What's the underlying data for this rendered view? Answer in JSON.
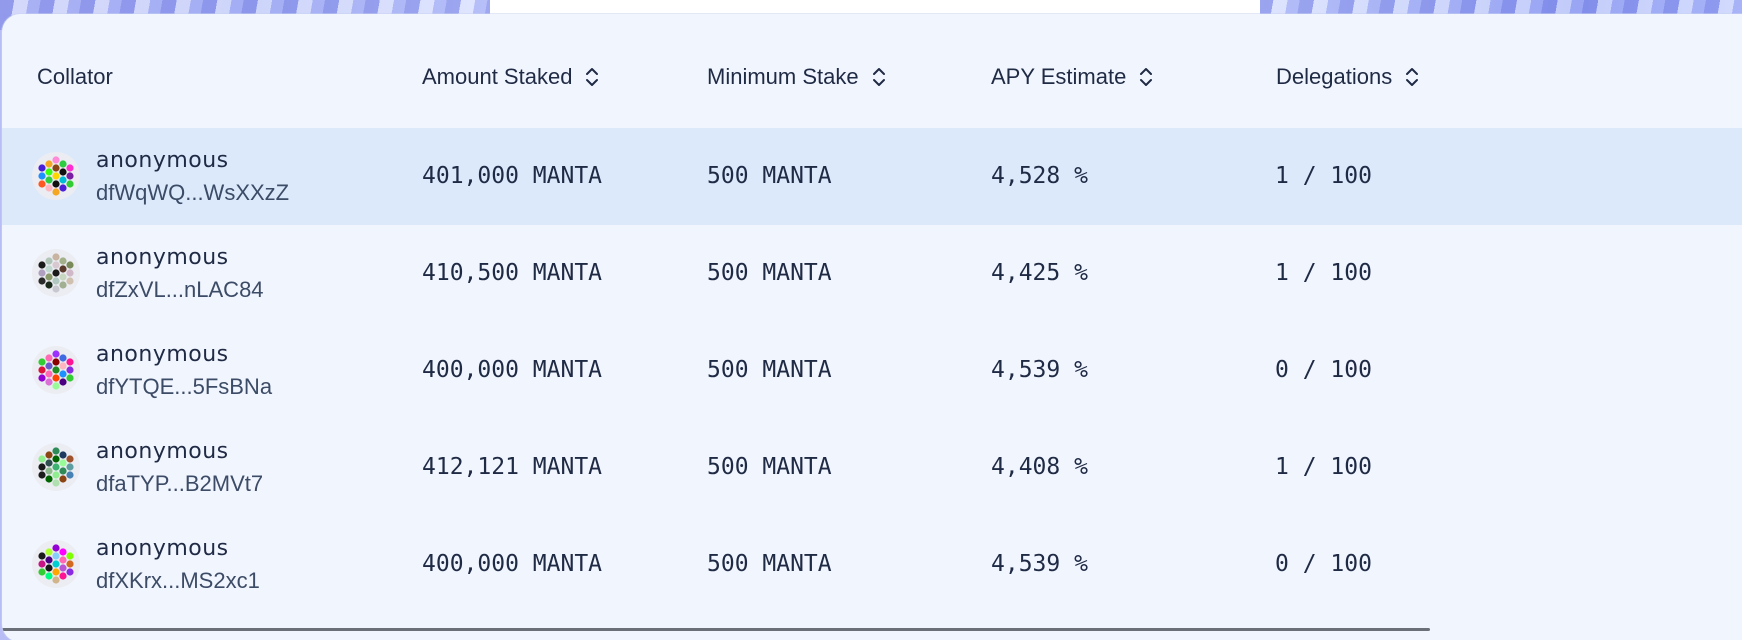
{
  "table": {
    "headers": [
      {
        "label": "Collator",
        "sortable": false
      },
      {
        "label": "Amount Staked",
        "sortable": true
      },
      {
        "label": "Minimum Stake",
        "sortable": true
      },
      {
        "label": "APY Estimate",
        "sortable": true
      },
      {
        "label": "Delegations",
        "sortable": true
      }
    ],
    "rows": [
      {
        "name": "anonymous",
        "address": "dfWqWQ...WsXXzZ",
        "amount_staked": "401,000 MANTA",
        "minimum_stake": "500 MANTA",
        "apy": "4,528 %",
        "delegations": "1 / 100",
        "avatar_colors": [
          "#ff8ad8",
          "#f5a623",
          "#2ecc40",
          "#4a1fd8",
          "#8b4513",
          "#ff2fd0",
          "#39ff14",
          "#111111",
          "#1e90ff",
          "#ffd700",
          "#7b1fa2",
          "#2ecc40",
          "#00bcd4",
          "#ff5722",
          "#111111",
          "#32cd32",
          "#ffb6c1",
          "#4a1fd8",
          "#f5a623"
        ]
      },
      {
        "name": "anonymous",
        "address": "dfZxVL...nLAC84",
        "amount_staked": "410,500 MANTA",
        "minimum_stake": "500 MANTA",
        "apy": "4,425 %",
        "delegations": "1 / 100",
        "avatar_colors": [
          "#c8b4a0",
          "#b0c4b8",
          "#a3b18a",
          "#1a1a1a",
          "#d8c8d0",
          "#7a8b5a",
          "#c0d8d0",
          "#5a3a2a",
          "#b0a0c0",
          "#1a1a1a",
          "#d0b8c8",
          "#8a9a6a",
          "#c8d8c0",
          "#2a2a2a",
          "#b0c8c0",
          "#d0c0b0",
          "#1a2a1a",
          "#a0b090",
          "#c8c8d0"
        ]
      },
      {
        "name": "anonymous",
        "address": "dfYTQE...5FsBNa",
        "amount_staked": "400,000 MANTA",
        "minimum_stake": "500 MANTA",
        "apy": "4,539 %",
        "delegations": "0 / 100",
        "avatar_colors": [
          "#9b30ff",
          "#ff69b4",
          "#4169e1",
          "#32cd32",
          "#8b0000",
          "#ff1493",
          "#6a5acd",
          "#ffb6c1",
          "#dc143c",
          "#228b22",
          "#8a2be2",
          "#ff69b4",
          "#1e90ff",
          "#9400d3",
          "#ff4500",
          "#32cd32",
          "#da70d6",
          "#4b0082",
          "#98fb98"
        ]
      },
      {
        "name": "anonymous",
        "address": "dfaTYP...B2MVt7",
        "amount_staked": "412,121 MANTA",
        "minimum_stake": "500 MANTA",
        "apy": "4,408 %",
        "delegations": "1 / 100",
        "avatar_colors": [
          "#2e8b57",
          "#8b4513",
          "#1e3a5f",
          "#90ee90",
          "#006400",
          "#a0522d",
          "#2f4f4f",
          "#98fb98",
          "#1a1a1a",
          "#3cb371",
          "#5f9ea0",
          "#8fbc8f",
          "#2e8b57",
          "#1c1c1c",
          "#90ee90",
          "#4682b4",
          "#006400",
          "#8b4513",
          "#b0e0b0"
        ]
      },
      {
        "name": "anonymous",
        "address": "dfXKrx...MS2xc1",
        "amount_staked": "400,000 MANTA",
        "minimum_stake": "500 MANTA",
        "apy": "4,539 %",
        "delegations": "0 / 100",
        "avatar_colors": [
          "#9400d3",
          "#adff2f",
          "#ff00ff",
          "#1a1a1a",
          "#87cefa",
          "#7fff00",
          "#4b0082",
          "#ff69b4",
          "#c71585",
          "#00ced1",
          "#d2691e",
          "#1a1a1a",
          "#ba55d3",
          "#32cd32",
          "#ffa500",
          "#8a2be2",
          "#00ff7f",
          "#ff1493",
          "#d2b48c"
        ]
      }
    ]
  },
  "colors": {
    "card_bg": "#f1f5fe",
    "highlight_row": "#dbe9fb",
    "text": "#1f2a44"
  }
}
